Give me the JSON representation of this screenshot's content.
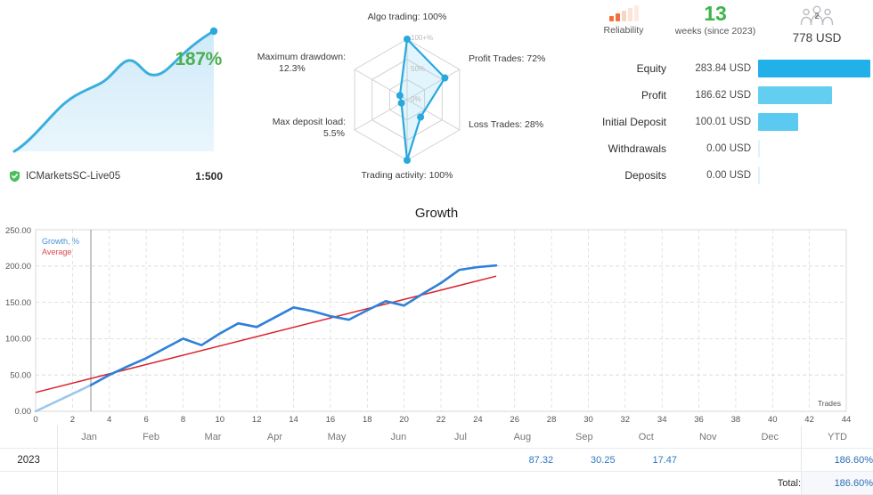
{
  "account": {
    "growth_percent": "187%",
    "broker_name": "ICMarketsSC-Live05",
    "leverage": "1:500",
    "verified_icon": "shield-check-icon"
  },
  "radar": {
    "inner_labels": {
      "outer": "100+%",
      "mid": "50%",
      "center": "0%"
    },
    "axes": [
      {
        "key": "algo_trading",
        "label": "Algo trading: 100%",
        "value": 100
      },
      {
        "key": "profit_trades",
        "label": "Profit Trades: 72%",
        "value": 72
      },
      {
        "key": "loss_trades",
        "label": "Loss Trades: 28%",
        "value": 28
      },
      {
        "key": "trading_activity",
        "label": "Trading activity: 100%",
        "value": 100
      },
      {
        "key": "max_deposit_load",
        "label": "Max deposit load:",
        "label2": "5.5%",
        "value": 5.5
      },
      {
        "key": "maximum_drawdown",
        "label": "Maximum drawdown:",
        "label2": "12.3%",
        "value": 12.3
      }
    ]
  },
  "badges": {
    "reliability": {
      "caption": "Reliability",
      "icon": "signal-bars-icon",
      "filled": 2,
      "total": 5
    },
    "weeks": {
      "number": "13",
      "caption": "weeks (since 2023)"
    },
    "subscribers": {
      "icon": "people-group-icon",
      "count": "2",
      "value": "778 USD"
    }
  },
  "stats": [
    {
      "label": "Equity",
      "value": "283.84 USD",
      "bar_ratio": 1.0,
      "color": "#22b0e8"
    },
    {
      "label": "Profit",
      "value": "186.62 USD",
      "bar_ratio": 0.657,
      "color": "#64cef0"
    },
    {
      "label": "Initial Deposit",
      "value": "100.01 USD",
      "bar_ratio": 0.352,
      "color": "#5ccaf0"
    },
    {
      "label": "Withdrawals",
      "value": "0.00 USD",
      "bar_ratio": 0.0,
      "color": "#dff1fb"
    },
    {
      "label": "Deposits",
      "value": "0.00 USD",
      "bar_ratio": 0.0,
      "color": "#dff1fb"
    }
  ],
  "chart_data": {
    "type": "line",
    "title": "Growth",
    "xlabel": "Trades",
    "ylabel": "",
    "xlim": [
      0,
      44
    ],
    "ylim": [
      0,
      250
    ],
    "xticks": [
      0,
      2,
      4,
      6,
      8,
      10,
      12,
      14,
      16,
      18,
      20,
      22,
      24,
      26,
      28,
      30,
      32,
      34,
      36,
      38,
      40,
      42,
      44
    ],
    "yticks": [
      "0.00",
      "50.00",
      "100.00",
      "150.00",
      "200.00",
      "250.00"
    ],
    "grid": true,
    "legend_position": "top-left",
    "legend": [
      {
        "name": "Growth, %",
        "color": "#2f80d8"
      },
      {
        "name": "Average",
        "color": "#d9232e"
      }
    ],
    "series": [
      {
        "name": "Growth, %",
        "color": "#2f80d8",
        "x": [
          0,
          1,
          2,
          3,
          4,
          5,
          6,
          7,
          8,
          9,
          10,
          11,
          12,
          13,
          14,
          15,
          16,
          17,
          18,
          19,
          20,
          21,
          22,
          23,
          24,
          25
        ],
        "y": [
          0,
          12,
          24,
          36,
          50,
          62,
          73,
          86,
          100,
          92,
          108,
          122,
          117,
          130,
          143,
          138,
          131,
          120,
          115,
          128,
          140,
          134,
          150,
          165,
          182,
          186
        ]
      },
      {
        "name": "Average",
        "color": "#d9232e",
        "x": [
          0,
          25
        ],
        "y": [
          26,
          186
        ]
      }
    ],
    "annotations": [
      {
        "type": "vline",
        "x": 3,
        "color": "#808080"
      }
    ]
  },
  "monthly_table": {
    "columns": [
      "",
      "Jan",
      "Feb",
      "Mar",
      "Apr",
      "May",
      "Jun",
      "Jul",
      "Aug",
      "Sep",
      "Oct",
      "Nov",
      "Dec",
      "YTD"
    ],
    "rows": [
      {
        "year": "2023",
        "months": [
          "",
          "",
          "",
          "",
          "",
          "",
          "",
          "87.32",
          "30.25",
          "17.47",
          "",
          ""
        ],
        "ytd": "186.60%"
      }
    ],
    "total_label": "Total:",
    "total_value": "186.60%"
  }
}
